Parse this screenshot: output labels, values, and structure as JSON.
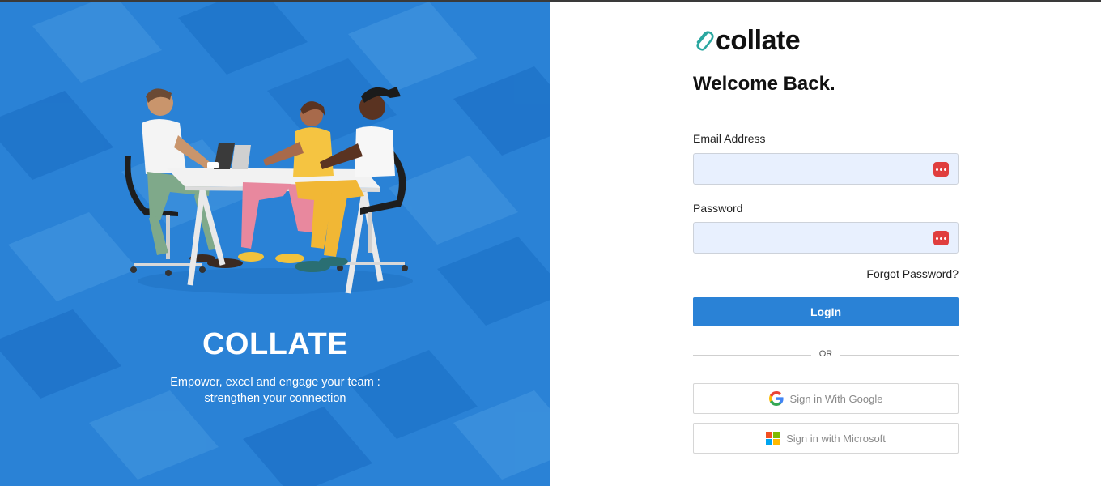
{
  "hero": {
    "title": "COLLATE",
    "subtitle": "Empower, excel and engage your team : strengthen your connection",
    "background_color": "#2a82d6",
    "illustration": "team-meeting-illustration"
  },
  "brand": {
    "logo_text": "collate",
    "logo_icon": "paperclip-icon",
    "accent_color": "#2aa7a0"
  },
  "login": {
    "heading": "Welcome Back.",
    "email_label": "Email Address",
    "email_value": "",
    "password_label": "Password",
    "password_value": "",
    "password_manager_icon": "password-manager-icon",
    "forgot_label": "Forgot Password?",
    "submit_label": "LogIn",
    "submit_color": "#2a82d6",
    "divider_text": "OR"
  },
  "sso": {
    "google_label": "Sign in With Google",
    "google_icon": "google-icon",
    "microsoft_label": "Sign in with Microsoft",
    "microsoft_icon": "microsoft-icon"
  }
}
